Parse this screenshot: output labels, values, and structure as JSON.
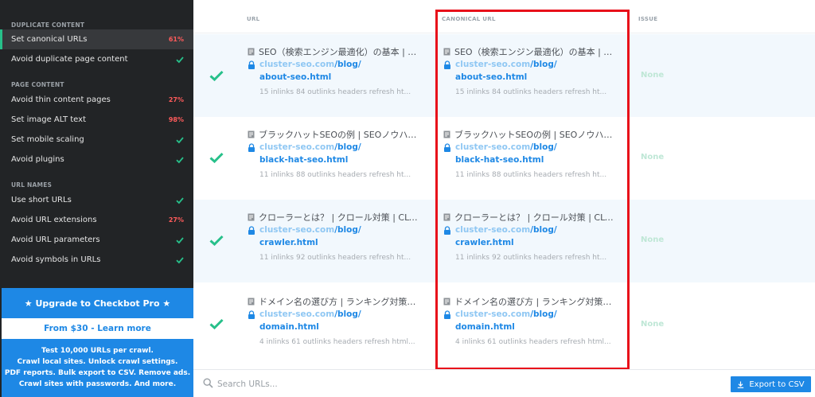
{
  "sidebar": {
    "sections": [
      {
        "title": "DUPLICATE CONTENT",
        "items": [
          {
            "label": "Set canonical URLs",
            "status": "61%",
            "type": "pct",
            "active": true
          },
          {
            "label": "Avoid duplicate page content",
            "status": "",
            "type": "check"
          }
        ]
      },
      {
        "title": "PAGE CONTENT",
        "items": [
          {
            "label": "Avoid thin content pages",
            "status": "27%",
            "type": "pct"
          },
          {
            "label": "Set image ALT text",
            "status": "98%",
            "type": "pct"
          },
          {
            "label": "Set mobile scaling",
            "status": "",
            "type": "check"
          },
          {
            "label": "Avoid plugins",
            "status": "",
            "type": "check"
          }
        ]
      },
      {
        "title": "URL NAMES",
        "items": [
          {
            "label": "Use short URLs",
            "status": "",
            "type": "check"
          },
          {
            "label": "Avoid URL extensions",
            "status": "27%",
            "type": "pct"
          },
          {
            "label": "Avoid URL parameters",
            "status": "",
            "type": "check"
          },
          {
            "label": "Avoid symbols in URLs",
            "status": "",
            "type": "check"
          }
        ]
      }
    ],
    "upgrade": {
      "title": "★ Upgrade to Checkbot Pro ★",
      "button": "From $30 - Learn more",
      "lines": [
        "Test 10,000 URLs per crawl.",
        "Crawl local sites. Unlock crawl settings.",
        "PDF reports. Bulk export to CSV. Remove ads.",
        "Crawl sites with passwords. And more."
      ]
    }
  },
  "table": {
    "headers": {
      "url": "URL",
      "canonical": "CANONICAL URL",
      "issue": "ISSUE"
    },
    "rows": [
      {
        "url": {
          "title": "SEO（検索エンジン最適化）の基本 | SEO...",
          "host": "cluster-seo.com",
          "path": "/blog/",
          "file": "about-seo.html",
          "meta": "15 inlinks   84 outlinks   headers   refresh   ht..."
        },
        "canonical": {
          "title": "SEO（検索エンジン最適化）の基本 | SEO...",
          "host": "cluster-seo.com",
          "path": "/blog/",
          "file": "about-seo.html",
          "meta": "15 inlinks   84 outlinks   headers   refresh   ht..."
        },
        "issue": "None"
      },
      {
        "url": {
          "title": "ブラックハットSEOの例 | SEOノウハウ...",
          "host": "cluster-seo.com",
          "path": "/blog/",
          "file": "black-hat-seo.html",
          "meta": "11 inlinks   88 outlinks   headers   refresh   ht..."
        },
        "canonical": {
          "title": "ブラックハットSEOの例 | SEOノウハウ...",
          "host": "cluster-seo.com",
          "path": "/blog/",
          "file": "black-hat-seo.html",
          "meta": "11 inlinks   88 outlinks   headers   refresh   ht..."
        },
        "issue": "None"
      },
      {
        "url": {
          "title": "クローラーとは？ | クロール対策 | CLUS...",
          "host": "cluster-seo.com",
          "path": "/blog/",
          "file": "crawler.html",
          "meta": "11 inlinks   92 outlinks   headers   refresh   ht..."
        },
        "canonical": {
          "title": "クローラーとは？ | クロール対策 | CLUS...",
          "host": "cluster-seo.com",
          "path": "/blog/",
          "file": "crawler.html",
          "meta": "11 inlinks   92 outlinks   headers   refresh   ht..."
        },
        "issue": "None"
      },
      {
        "url": {
          "title": "ドメイン名の選び方 | ランキング対策 | ...",
          "host": "cluster-seo.com",
          "path": "/blog/",
          "file": "domain.html",
          "meta": "4 inlinks   61 outlinks   headers   refresh   html..."
        },
        "canonical": {
          "title": "ドメイン名の選び方 | ランキング対策 | ...",
          "host": "cluster-seo.com",
          "path": "/blog/",
          "file": "domain.html",
          "meta": "4 inlinks   61 outlinks   headers   refresh   html..."
        },
        "issue": "None"
      }
    ]
  },
  "footer": {
    "search_placeholder": "Search URLs...",
    "export_label": "Export to CSV"
  },
  "colors": {
    "sidebar_bg": "#222426",
    "accent_blue": "#1e88e5",
    "check_green": "#27c08a",
    "pct_red": "#ff5b5b",
    "highlight_red": "#e8101a"
  }
}
